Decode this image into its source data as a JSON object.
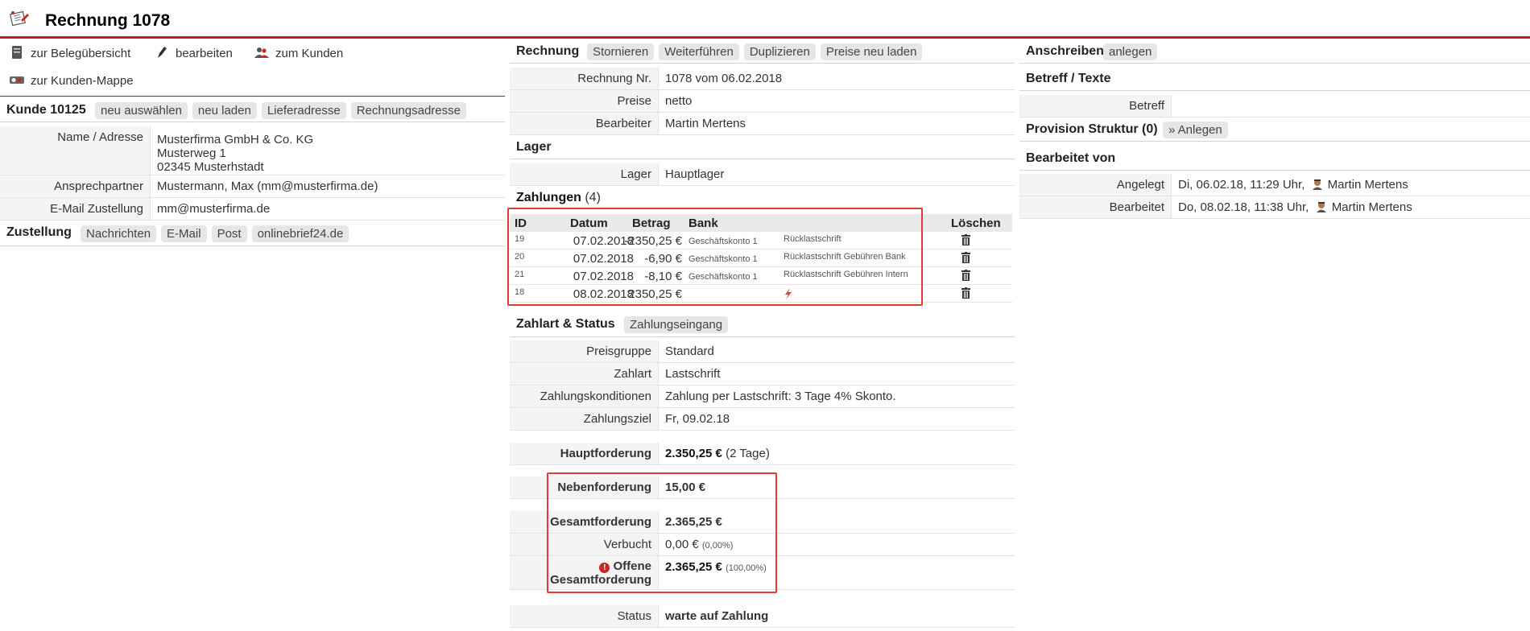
{
  "header": {
    "title": "Rechnung 1078",
    "icon": "invoice-icon"
  },
  "left": {
    "actions": [
      {
        "label": "zur Belegübersicht",
        "icon": "document-icon"
      },
      {
        "label": "bearbeiten",
        "icon": "pencil-icon"
      },
      {
        "label": "zum Kunden",
        "icon": "users-icon"
      },
      {
        "label": "zur Kunden-Mappe",
        "icon": "folder-icon"
      }
    ],
    "customer": {
      "heading": "Kunde 10125",
      "buttons": [
        "neu auswählen",
        "neu laden",
        "Lieferadresse",
        "Rechnungsadresse"
      ],
      "rows": [
        {
          "key": "Name / Adresse",
          "lines": [
            "Musterfirma GmbH & Co. KG",
            "Musterweg 1",
            "02345 Musterhstadt"
          ]
        },
        {
          "key": "Ansprechpartner",
          "value": "Mustermann, Max (mm@musterfirma.de)"
        },
        {
          "key": "E-Mail Zustellung",
          "value": "mm@musterfirma.de"
        }
      ]
    },
    "delivery": {
      "heading": "Zustellung",
      "buttons": [
        "Nachrichten",
        "E-Mail",
        "Post",
        "onlinebrief24.de"
      ]
    }
  },
  "middle": {
    "invoice": {
      "heading": "Rechnung",
      "buttons": [
        "Stornieren",
        "Weiterführen",
        "Duplizieren",
        "Preise neu laden"
      ],
      "rows": [
        {
          "key": "Rechnung Nr.",
          "value": "1078 vom 06.02.2018"
        },
        {
          "key": "Preise",
          "value": "netto"
        },
        {
          "key": "Bearbeiter",
          "value": "Martin Mertens"
        }
      ]
    },
    "stock": {
      "heading": "Lager",
      "rows": [
        {
          "key": "Lager",
          "value": "Hauptlager"
        }
      ]
    },
    "payments": {
      "heading": "Zahlungen",
      "count": "(4)",
      "columns": {
        "id": "ID",
        "date": "Datum",
        "amount": "Betrag",
        "bank": "Bank",
        "delete": "Löschen"
      },
      "rows": [
        {
          "id": "19",
          "date": "07.02.2018",
          "amount": "-2350,25 €",
          "bank": "Geschäftskonto 1",
          "note": "Rücklastschrift"
        },
        {
          "id": "20",
          "date": "07.02.2018",
          "amount": "-6,90 €",
          "bank": "Geschäftskonto 1",
          "note": "Rücklastschrift Gebühren Bank"
        },
        {
          "id": "21",
          "date": "07.02.2018",
          "amount": "-8,10 €",
          "bank": "Geschäftskonto 1",
          "note": "Rücklastschrift Gebühren Intern"
        },
        {
          "id": "18",
          "date": "08.02.2018",
          "amount": "2350,25 €",
          "bank": "",
          "note": ""
        }
      ]
    },
    "status_section": {
      "heading": "Zahlart & Status",
      "button": "Zahlungseingang",
      "rows": [
        {
          "key": "Preisgruppe",
          "value": "Standard"
        },
        {
          "key": "Zahlart",
          "value": "Lastschrift"
        },
        {
          "key": "Zahlungskonditionen",
          "value": "Zahlung per Lastschrift: 3 Tage 4% Skonto."
        },
        {
          "key": "Zahlungsziel",
          "value": "Fr, 09.02.18"
        }
      ]
    },
    "totals": {
      "main_claim": {
        "key": "Hauptforderung",
        "value": "2.350,25 €",
        "extra": "(2 Tage)"
      },
      "side_claim": {
        "key": "Nebenforderung",
        "value": "15,00 €"
      },
      "total_claim": {
        "key": "Gesamtforderung",
        "value": "2.365,25 €"
      },
      "booked": {
        "key": "Verbucht",
        "value": "0,00 €",
        "extra": "(0,00%)"
      },
      "open": {
        "key_line1": "Offene",
        "key_line2": "Gesamtforderung",
        "value": "2.365,25 €",
        "extra": "(100,00%)"
      },
      "status": {
        "key": "Status",
        "value": "warte auf Zahlung"
      }
    }
  },
  "right": {
    "letter": {
      "heading": "Anschreiben",
      "button": "anlegen"
    },
    "texts": {
      "heading": "Betreff / Texte",
      "rows": [
        {
          "key": "Betreff",
          "value": ""
        }
      ]
    },
    "commission": {
      "heading": "Provision Struktur (0)",
      "button": "» Anlegen"
    },
    "edited": {
      "heading": "Bearbeitet von",
      "rows": [
        {
          "key": "Angelegt",
          "date": "Di, 06.02.18, 11:29 Uhr,",
          "user": "Martin Mertens"
        },
        {
          "key": "Bearbeitet",
          "date": "Do, 08.02.18, 11:38 Uhr,",
          "user": "Martin Mertens"
        }
      ]
    }
  },
  "colors": {
    "accent": "#b8202a",
    "highlight": "#e53935",
    "label_bg": "#f4f4f4",
    "pill_bg": "#e6e6e6"
  }
}
